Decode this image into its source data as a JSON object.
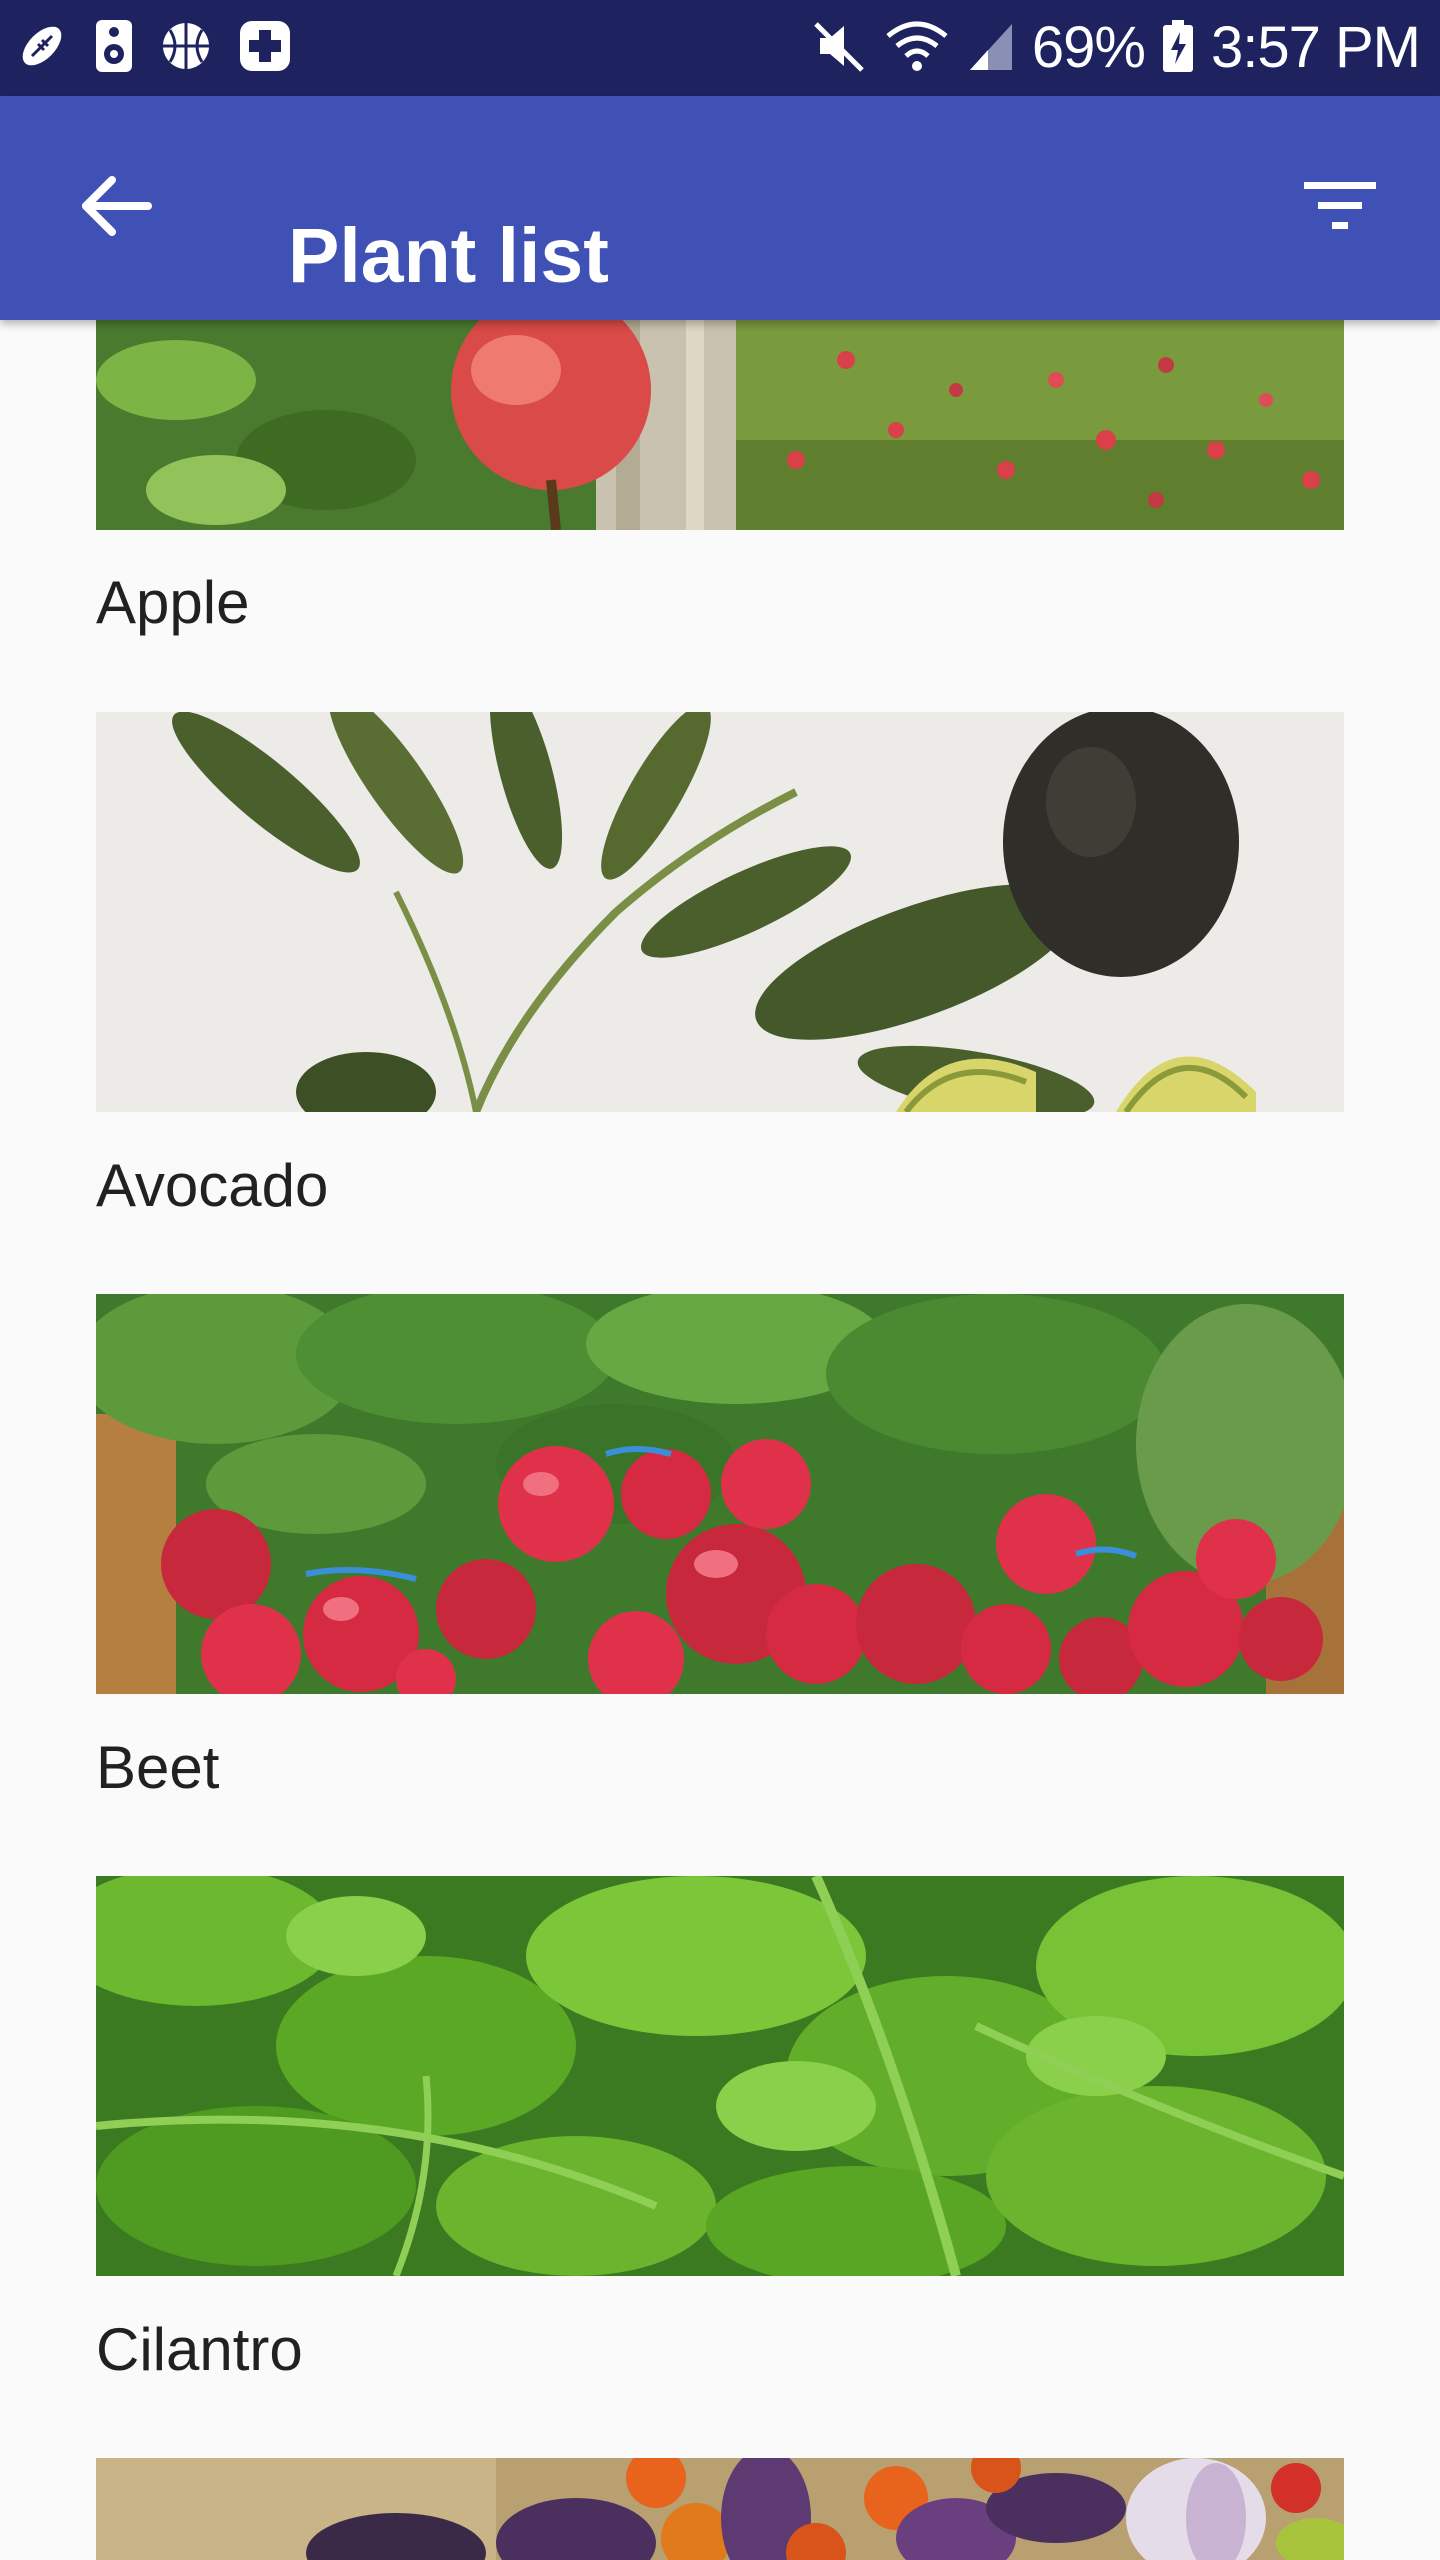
{
  "status_bar": {
    "battery": "69%",
    "time": "3:57 PM"
  },
  "app_bar": {
    "title": "Plant list"
  },
  "plants": [
    {
      "name": "Apple"
    },
    {
      "name": "Avocado"
    },
    {
      "name": "Beet"
    },
    {
      "name": "Cilantro"
    }
  ],
  "colors": {
    "status_bar": "#1e2360",
    "app_bar": "#3f51b5",
    "background": "#fafafa",
    "text": "#212121"
  }
}
